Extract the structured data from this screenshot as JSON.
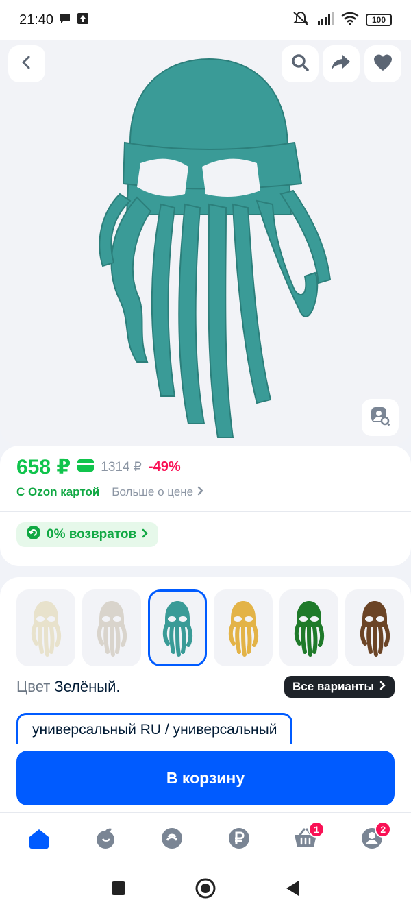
{
  "status_bar": {
    "time": "21:40",
    "battery": "100"
  },
  "hero": {
    "icons": [
      "back-icon",
      "search-icon",
      "share-icon",
      "heart-icon",
      "image-search-icon"
    ],
    "product_color": "#3a9b97"
  },
  "price": {
    "current": "658 ₽",
    "old": "1314 ₽",
    "discount": "-49%",
    "ozon_card": "С Ozon картой",
    "more_about_price": "Больше о цене",
    "returns": "0% возвратов"
  },
  "variants": {
    "thumbnails": [
      {
        "color": "#e8e2cc",
        "selected": false
      },
      {
        "color": "#d9d4cc",
        "selected": false
      },
      {
        "color": "#3a9b97",
        "selected": true
      },
      {
        "color": "#e3b347",
        "selected": false
      },
      {
        "color": "#1f7a2a",
        "selected": false
      },
      {
        "color": "#6b4426",
        "selected": false
      }
    ],
    "color_label": "Цвет",
    "color_value": "Зелёный.",
    "all_variants": "Все варианты",
    "size_value": "универсальный RU / универсальный"
  },
  "cart_button": "В корзину",
  "bottom_nav": {
    "items": [
      {
        "icon": "home-icon",
        "active": true
      },
      {
        "icon": "fresh-icon",
        "active": false
      },
      {
        "icon": "ozon-logo-icon",
        "active": false
      },
      {
        "icon": "ruble-icon",
        "active": false
      },
      {
        "icon": "cart-icon",
        "active": false,
        "badge": "1"
      },
      {
        "icon": "profile-icon",
        "active": false,
        "badge": "2"
      }
    ]
  },
  "colors": {
    "accent": "#005bff",
    "price_green": "#10c44c",
    "discount_pink": "#f91155"
  }
}
